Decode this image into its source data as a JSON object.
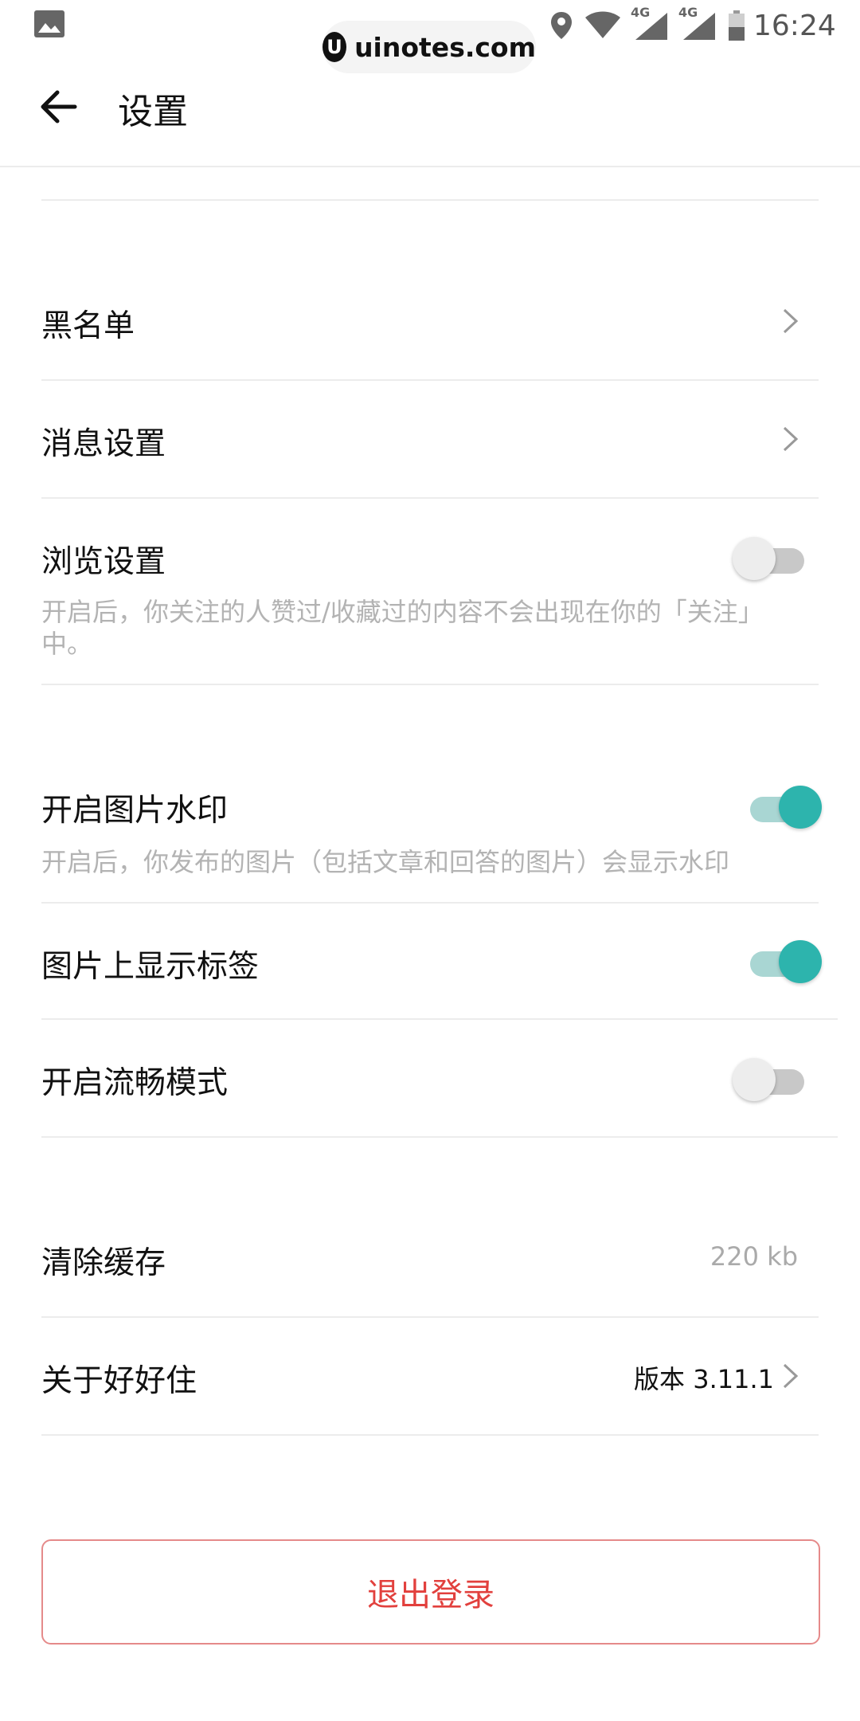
{
  "status_bar": {
    "watermark_text": "uinotes.com",
    "network_1": "4G",
    "network_2": "4G",
    "time": "16:24"
  },
  "header": {
    "title": "设置",
    "back_icon": "arrow-left-icon"
  },
  "settings": {
    "blacklist": {
      "label": "黑名单"
    },
    "message_settings": {
      "label": "消息设置"
    },
    "browse_settings": {
      "label": "浏览设置",
      "description": "开启后，你关注的人赞过/收藏过的内容不会出现在你的「关注」中。",
      "enabled": false
    },
    "image_watermark": {
      "label": "开启图片水印",
      "description": "开启后，你发布的图片（包括文章和回答的图片）会显示水印",
      "enabled": true
    },
    "image_tags": {
      "label": "图片上显示标签",
      "enabled": true
    },
    "smooth_mode": {
      "label": "开启流畅模式",
      "enabled": false
    },
    "clear_cache": {
      "label": "清除缓存",
      "value": "220 kb"
    },
    "about": {
      "label": "关于好好住",
      "version": "版本 3.11.1"
    }
  },
  "logout_label": "退出登录",
  "colors": {
    "accent": "#2db4ad",
    "danger": "#e2403d"
  }
}
